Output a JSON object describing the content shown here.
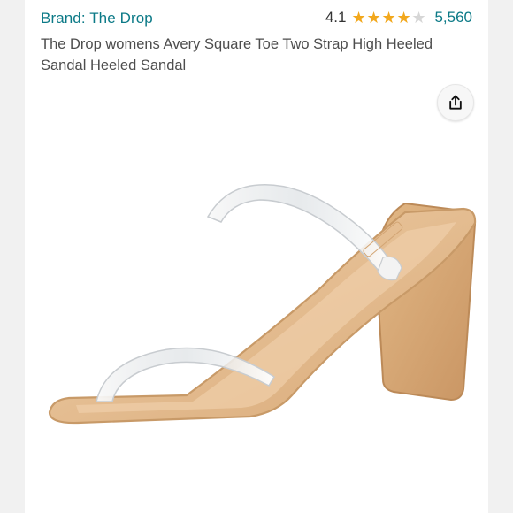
{
  "product": {
    "brand": "Brand: The Drop",
    "rating": "4.1",
    "rating_value": 4.1,
    "review_count": "5,560",
    "title": "The Drop womens Avery Square Toe Two Strap High Heeled Sandal Heeled Sandal"
  },
  "icons": {
    "share": "share-icon",
    "star": "star-icon"
  },
  "colors": {
    "brand_link": "#0c7a87",
    "star": "#f2a81d",
    "sandal": "#d8ad79"
  }
}
